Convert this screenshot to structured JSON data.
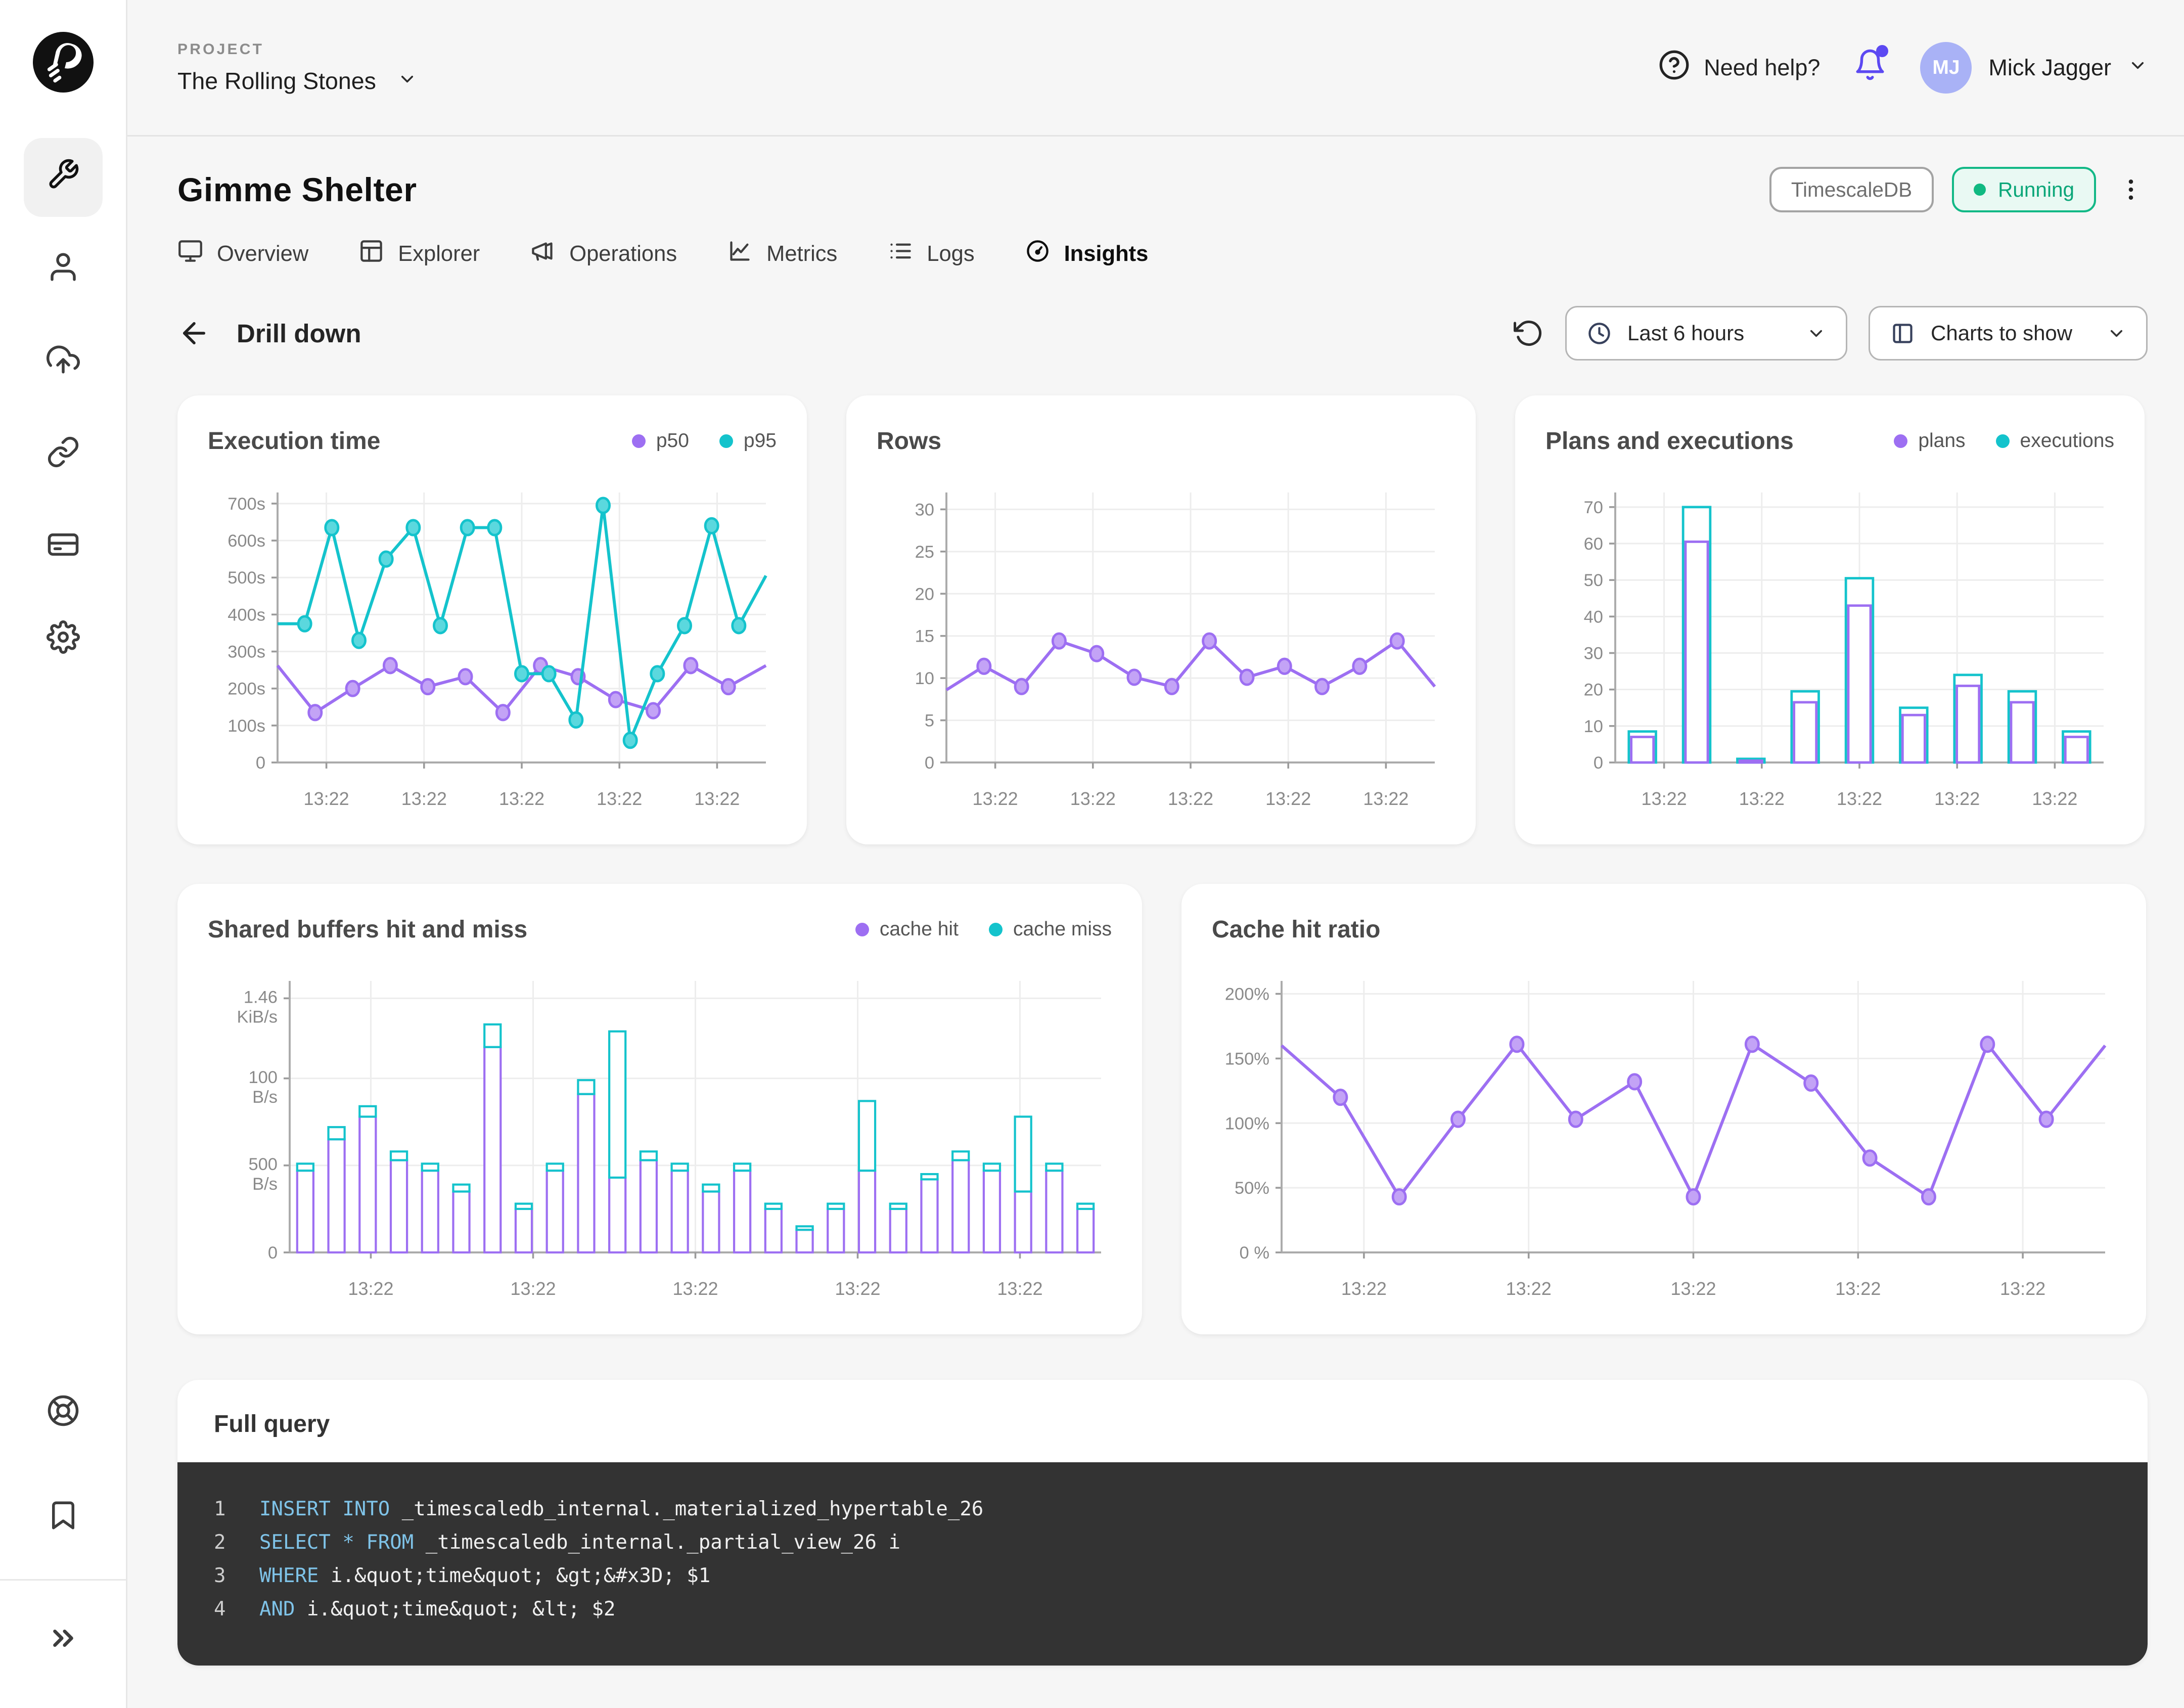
{
  "app": {
    "header": {
      "project_label": "PROJECT",
      "project_name": "The Rolling Stones",
      "need_help": "Need help?",
      "user_initials": "MJ",
      "user_name": "Mick Jagger"
    },
    "sidebar": {
      "items": [
        "wrench-icon",
        "user-icon",
        "cloud-upload-icon",
        "link-icon",
        "credit-card-icon",
        "gear-icon"
      ],
      "bottom_items": [
        "life-buoy-icon",
        "bookmark-icon",
        "chevrons-right-icon"
      ]
    },
    "service": {
      "title": "Gimme Shelter",
      "type_badge": "TimescaleDB",
      "status_badge": "Running",
      "tabs": [
        {
          "label": "Overview",
          "icon": "monitor-icon",
          "active": false
        },
        {
          "label": "Explorer",
          "icon": "table-icon",
          "active": false
        },
        {
          "label": "Operations",
          "icon": "megaphone-icon",
          "active": false
        },
        {
          "label": "Metrics",
          "icon": "line-chart-icon",
          "active": false
        },
        {
          "label": "Logs",
          "icon": "list-icon",
          "active": false
        },
        {
          "label": "Insights",
          "icon": "gauge-icon",
          "active": true
        }
      ]
    },
    "toolbar": {
      "back_label": "Drill down",
      "time_range": "Last 6 hours",
      "charts_to_show": "Charts to show"
    },
    "colors": {
      "purple": "#9d6ff2",
      "purple_fill": "#c3a3f6",
      "teal": "#14c3cc",
      "teal_fill": "#5bd8de",
      "accent_bell": "#5c49f2",
      "running_green": "#10b981",
      "code_keyword": "#7fc3e8",
      "code_bg": "#333333"
    },
    "full_query": {
      "title": "Full query",
      "lines": [
        {
          "num": "1",
          "tokens": [
            {
              "t": "INSERT INTO",
              "k": true
            },
            {
              "t": " _timescaledb_internal._materialized_hypertable_26",
              "k": false
            }
          ]
        },
        {
          "num": "2",
          "tokens": [
            {
              "t": "SELECT * FROM",
              "k": true
            },
            {
              "t": " _timescaledb_internal._partial_view_26 i",
              "k": false
            }
          ]
        },
        {
          "num": "3",
          "tokens": [
            {
              "t": "WHERE",
              "k": true
            },
            {
              "t": " i.&quot;time&quot; &gt;&#x3D; $1",
              "k": false
            }
          ]
        },
        {
          "num": "4",
          "tokens": [
            {
              "t": "AND",
              "k": true
            },
            {
              "t": " i.&quot;time&quot; &lt; $2",
              "k": false
            }
          ]
        }
      ]
    }
  },
  "chart_data": [
    {
      "type": "line",
      "title": "Execution time",
      "x_labels": [
        "13:22",
        "13:22",
        "13:22",
        "13:22",
        "13:22"
      ],
      "ymax": 730,
      "yticks": [
        {
          "v": 0,
          "l": "0"
        },
        {
          "v": 100,
          "l": "100s"
        },
        {
          "v": 200,
          "l": "200s"
        },
        {
          "v": 300,
          "l": "300s"
        },
        {
          "v": 400,
          "l": "400s"
        },
        {
          "v": 500,
          "l": "500s"
        },
        {
          "v": 600,
          "l": "600s"
        },
        {
          "v": 700,
          "l": "700s"
        }
      ],
      "legend_position": "top-right",
      "series": [
        {
          "name": "p50",
          "color": "#9d6ff2",
          "fill": "#c3a3f6",
          "values": [
            262,
            135,
            200,
            262,
            205,
            232,
            135,
            262,
            232,
            170,
            140,
            262,
            205,
            262
          ]
        },
        {
          "name": "p95",
          "color": "#14c3cc",
          "fill": "#5bd8de",
          "values": [
            375,
            375,
            635,
            330,
            550,
            635,
            370,
            635,
            635,
            240,
            240,
            115,
            695,
            60,
            240,
            370,
            640,
            370,
            505
          ]
        }
      ]
    },
    {
      "type": "line",
      "title": "Rows",
      "x_labels": [
        "13:22",
        "13:22",
        "13:22",
        "13:22",
        "13:22"
      ],
      "ymax": 32,
      "yticks": [
        {
          "v": 0,
          "l": "0"
        },
        {
          "v": 5,
          "l": "5"
        },
        {
          "v": 10,
          "l": "10"
        },
        {
          "v": 15,
          "l": "15"
        },
        {
          "v": 20,
          "l": "20"
        },
        {
          "v": 25,
          "l": "25"
        },
        {
          "v": 30,
          "l": "30"
        }
      ],
      "legend_position": "none",
      "series": [
        {
          "name": "rows",
          "color": "#9d6ff2",
          "fill": "#c3a3f6",
          "values": [
            8.6,
            11.4,
            9,
            14.4,
            12.9,
            10.1,
            9,
            14.4,
            10.1,
            11.4,
            9,
            11.4,
            14.4,
            9
          ]
        }
      ]
    },
    {
      "type": "bar-nested",
      "title": "Plans and executions",
      "x_labels": [
        "13:22",
        "13:22",
        "13:22",
        "13:22",
        "13:22"
      ],
      "ymax": 74,
      "yticks": [
        {
          "v": 0,
          "l": "0"
        },
        {
          "v": 10,
          "l": "10"
        },
        {
          "v": 20,
          "l": "20"
        },
        {
          "v": 30,
          "l": "30"
        },
        {
          "v": 40,
          "l": "40"
        },
        {
          "v": 50,
          "l": "50"
        },
        {
          "v": 60,
          "l": "60"
        },
        {
          "v": 70,
          "l": "70"
        }
      ],
      "legend_position": "top-right",
      "inner": {
        "name": "plans",
        "color": "#9d6ff2",
        "values": [
          7,
          60.5,
          0.5,
          16.5,
          43,
          13,
          21,
          16.5,
          7
        ]
      },
      "outer": {
        "name": "executions",
        "color": "#14c3cc",
        "values": [
          8.5,
          70,
          1,
          19.5,
          50.5,
          15,
          24,
          19.5,
          8.5
        ]
      }
    },
    {
      "type": "bar-stacked",
      "title": "Shared buffers hit and miss",
      "x_labels": [
        "13:22",
        "13:22",
        "13:22",
        "13:22",
        "13:22"
      ],
      "ymax": 1560,
      "ml": 54,
      "yticks": [
        {
          "v": 0,
          "l": "0"
        },
        {
          "v": 500,
          "l": "500\nB/s"
        },
        {
          "v": 1000,
          "l": "100\nB/s"
        },
        {
          "v": 1460,
          "l": "1.46\nKiB/s"
        }
      ],
      "legend_position": "top-right",
      "bottom": {
        "name": "cache hit",
        "color": "#9d6ff2",
        "values": [
          470,
          650,
          780,
          530,
          470,
          350,
          1180,
          250,
          470,
          910,
          430,
          530,
          470,
          350,
          470,
          250,
          130,
          250,
          470,
          250,
          420,
          530,
          470,
          350,
          470,
          250
        ]
      },
      "top": {
        "name": "cache miss",
        "color": "#14c3cc",
        "values": [
          40,
          70,
          60,
          50,
          40,
          40,
          130,
          30,
          40,
          80,
          840,
          50,
          40,
          40,
          40,
          30,
          20,
          30,
          400,
          30,
          30,
          50,
          40,
          430,
          40,
          30
        ]
      }
    },
    {
      "type": "line",
      "title": "Cache hit ratio",
      "x_labels": [
        "13:22",
        "13:22",
        "13:22",
        "13:22",
        "13:22"
      ],
      "ymax": 210,
      "yticks": [
        {
          "v": 0,
          "l": "0 %"
        },
        {
          "v": 50,
          "l": "50%"
        },
        {
          "v": 100,
          "l": "100%"
        },
        {
          "v": 150,
          "l": "150%"
        },
        {
          "v": 200,
          "l": "200%"
        }
      ],
      "legend_position": "none",
      "series": [
        {
          "name": "cache hit ratio",
          "color": "#9d6ff2",
          "fill": "#c3a3f6",
          "values": [
            160,
            120,
            43,
            103,
            161,
            103,
            132,
            43,
            161,
            131,
            73,
            43,
            161,
            103,
            160
          ]
        }
      ]
    }
  ]
}
